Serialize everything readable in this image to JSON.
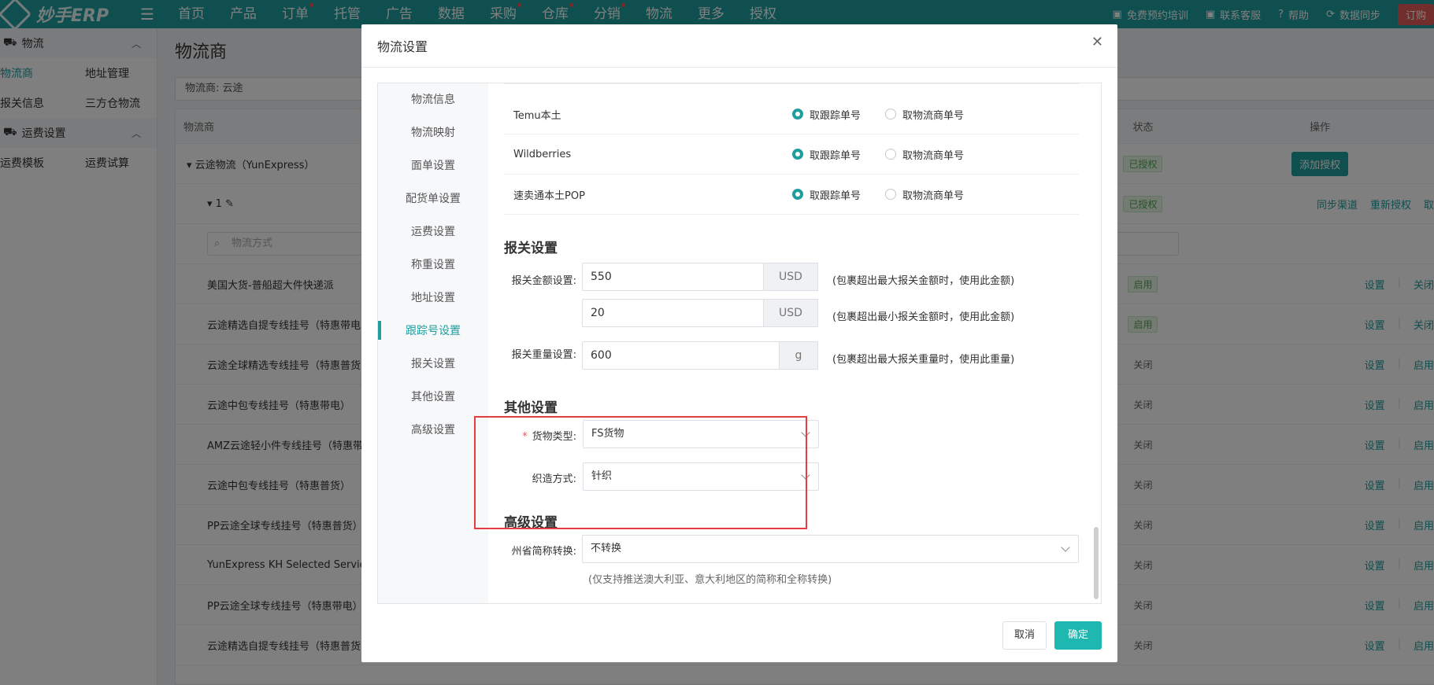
{
  "topbar": {
    "logo": "妙手ERP",
    "nav": [
      "首页",
      "产品",
      "订单",
      "托管",
      "广告",
      "数据",
      "采购",
      "仓库",
      "分销",
      "物流",
      "更多",
      "授权"
    ],
    "nav_dots": [
      false,
      false,
      true,
      false,
      false,
      false,
      true,
      true,
      true,
      false,
      false,
      false
    ],
    "right": [
      "免费预约培训",
      "联系客服",
      "帮助",
      "数据同步"
    ],
    "order": "订购"
  },
  "sidebar": {
    "group1": "物流",
    "rows1": [
      [
        "物流商",
        "地址管理"
      ],
      [
        "报关信息",
        "三方仓物流"
      ]
    ],
    "group2": "运费设置",
    "rows2": [
      [
        "运费模板",
        "运费试算"
      ]
    ]
  },
  "main": {
    "title": "物流商",
    "filter": "物流商:  云途",
    "thead": {
      "name": "物流商",
      "status": "状态",
      "ops": "操作"
    },
    "provider": "云途物流（YunExpress）",
    "provider_status": "已授权",
    "add_auth": "添加授权",
    "account": "1",
    "account_status": "已授权",
    "account_ops": [
      "同步渠道",
      "重新授权",
      "取"
    ],
    "search_placeholder": "物流方式",
    "rows": [
      {
        "name": "美国大货-普船超大件快递派",
        "status": "启用",
        "op1": "设置",
        "op2": "关闭"
      },
      {
        "name": "云途精选自提专线挂号（特惠带电",
        "status": "启用",
        "op1": "设置",
        "op2": "关闭"
      },
      {
        "name": "云途全球精选专线挂号（特惠普货",
        "status": "关闭",
        "op1": "设置",
        "op2": "启用"
      },
      {
        "name": "云途中包专线挂号（特惠带电）",
        "status": "关闭",
        "op1": "设置",
        "op2": "启用"
      },
      {
        "name": "AMZ云途轻小件专线挂号（特惠带",
        "status": "关闭",
        "op1": "设置",
        "op2": "启用"
      },
      {
        "name": "云途中包专线挂号（特惠普货）",
        "status": "关闭",
        "op1": "设置",
        "op2": "启用"
      },
      {
        "name": "PP云途全球专线挂号（特惠普货）",
        "status": "关闭",
        "op1": "设置",
        "op2": "启用"
      },
      {
        "name": "YunExpress KH Selected Service",
        "status": "关闭",
        "op1": "设置",
        "op2": "启用"
      },
      {
        "name": "PP云途全球专线挂号（特惠带电）",
        "status": "关闭",
        "op1": "设置",
        "op2": "启用"
      },
      {
        "name": "云途精选自提专线挂号（特惠普货",
        "status": "关闭",
        "op1": "设置",
        "op2": "启用"
      }
    ]
  },
  "modal": {
    "title": "物流设置",
    "tabs": [
      "物流信息",
      "物流映射",
      "面单设置",
      "配货单设置",
      "运费设置",
      "称重设置",
      "地址设置",
      "跟踪号设置",
      "报关设置",
      "其他设置",
      "高级设置"
    ],
    "active_tab": 7,
    "mapping": [
      {
        "name": "Temu本土",
        "opt1": "取跟踪单号",
        "opt2": "取物流商单号"
      },
      {
        "name": "Wildberries",
        "opt1": "取跟踪单号",
        "opt2": "取物流商单号"
      },
      {
        "name": "速卖通本土POP",
        "opt1": "取跟踪单号",
        "opt2": "取物流商单号"
      }
    ],
    "customs": {
      "title": "报关设置",
      "amount_label": "报关金额设置:",
      "max_value": "550",
      "max_unit": "USD",
      "max_hint": "(包裹超出最大报关金额时，使用此金额)",
      "min_value": "20",
      "min_unit": "USD",
      "min_hint": "(包裹超出最小报关金额时，使用此金额)",
      "weight_label": "报关重量设置:",
      "weight_value": "600",
      "weight_unit": "g",
      "weight_hint": "(包裹超出最大报关重量时，使用此重量)"
    },
    "other": {
      "title": "其他设置",
      "cargo_label": "货物类型:",
      "cargo_value": "FS货物",
      "weave_label": "织造方式:",
      "weave_value": "针织"
    },
    "advanced": {
      "title": "高级设置",
      "state_label": "州省简称转换:",
      "state_value": "不转换",
      "state_note": "(仅支持推送澳大利亚、意大利地区的简称和全称转换)"
    },
    "cancel": "取消",
    "confirm": "确定"
  },
  "colors": {
    "accent": "#1f9e9e",
    "highlight": "#e53e3e"
  }
}
